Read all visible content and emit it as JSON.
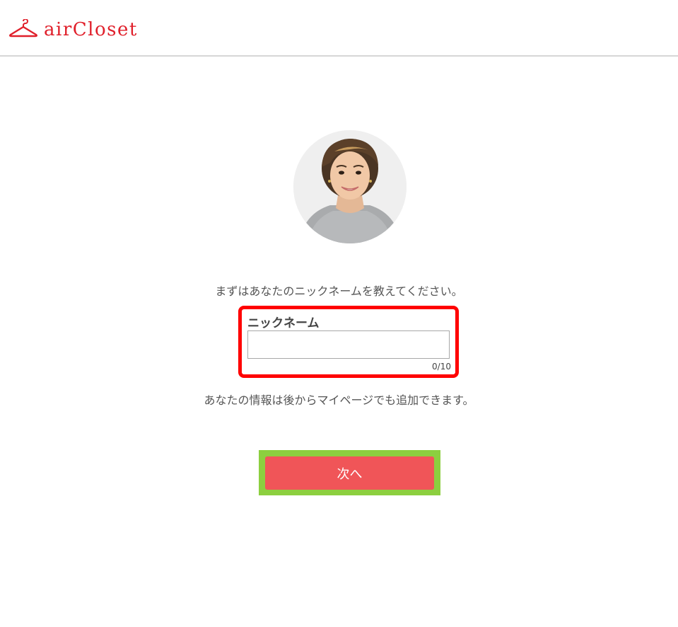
{
  "header": {
    "logo_text": "airCloset",
    "logo_icon": "hanger-icon",
    "brand_color": "#e0202b"
  },
  "profile": {
    "avatar": "stylist-photo"
  },
  "form": {
    "intro_text": "まずはあなたのニックネームを教えてください。",
    "nickname": {
      "label": "ニックネーム",
      "value": "",
      "counter": "0/10"
    },
    "note_text": "あなたの情報は後からマイページでも追加できます。",
    "next_button_label": "次へ",
    "button_color": "#f05558",
    "highlight_colors": {
      "input": "#ff0000",
      "button": "#8ccf3f"
    }
  }
}
